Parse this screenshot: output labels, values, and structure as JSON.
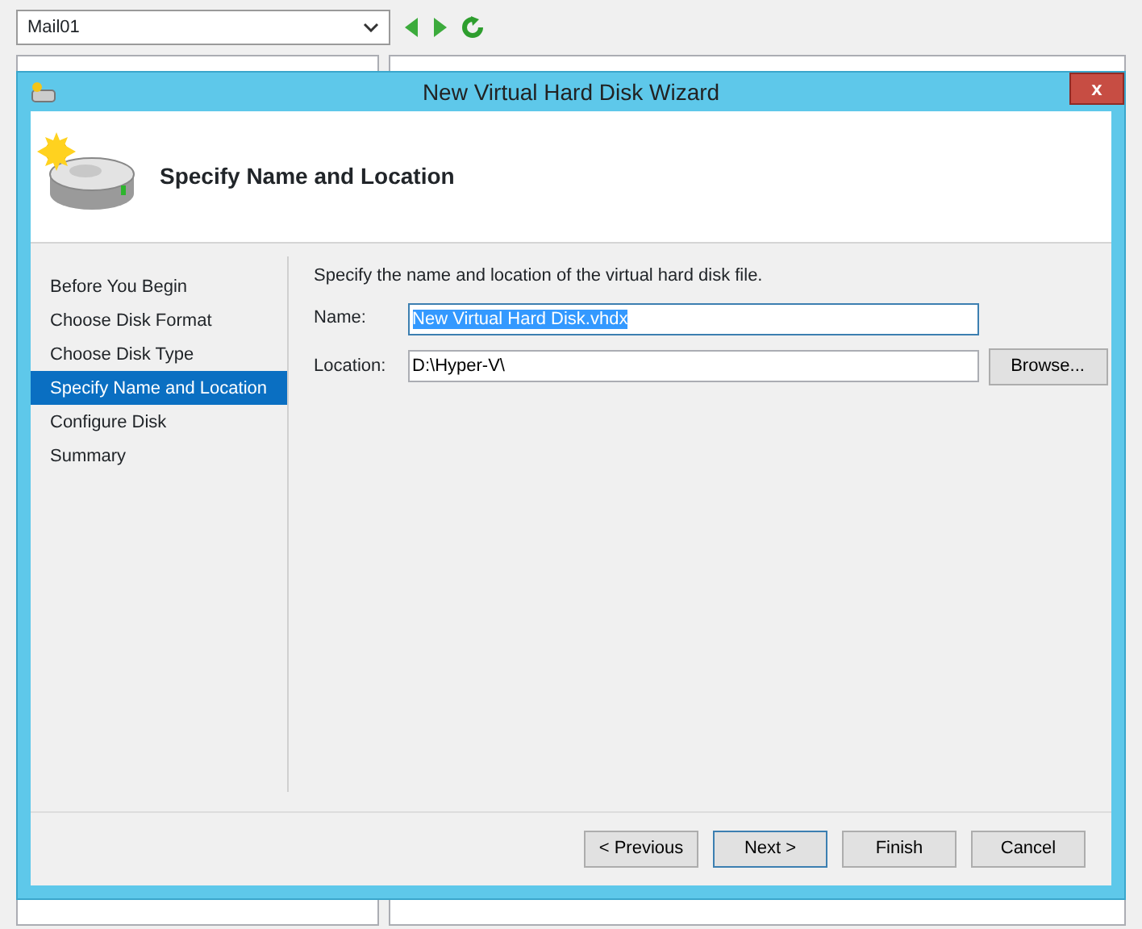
{
  "background": {
    "vm_select": {
      "value": "Mail01"
    }
  },
  "window": {
    "title": "New Virtual Hard Disk Wizard",
    "close": "x"
  },
  "header": {
    "title": "Specify Name and Location"
  },
  "steps": [
    {
      "label": "Before You Begin",
      "selected": false
    },
    {
      "label": "Choose Disk Format",
      "selected": false
    },
    {
      "label": "Choose Disk Type",
      "selected": false
    },
    {
      "label": "Specify Name and Location",
      "selected": true
    },
    {
      "label": "Configure Disk",
      "selected": false
    },
    {
      "label": "Summary",
      "selected": false
    }
  ],
  "description": "Specify the name and location of the virtual hard disk file.",
  "fields": [
    {
      "label": "Name:",
      "value": "New Virtual Hard Disk.vhdx",
      "selected": true
    },
    {
      "label": "Location:",
      "value": "D:\\Hyper-V\\",
      "selected": false,
      "button": "Browse..."
    }
  ],
  "buttons": [
    {
      "label": "< Previous",
      "default": false
    },
    {
      "label": "Next >",
      "default": true
    },
    {
      "label": "Finish",
      "default": false
    },
    {
      "label": "Cancel",
      "default": false
    }
  ]
}
